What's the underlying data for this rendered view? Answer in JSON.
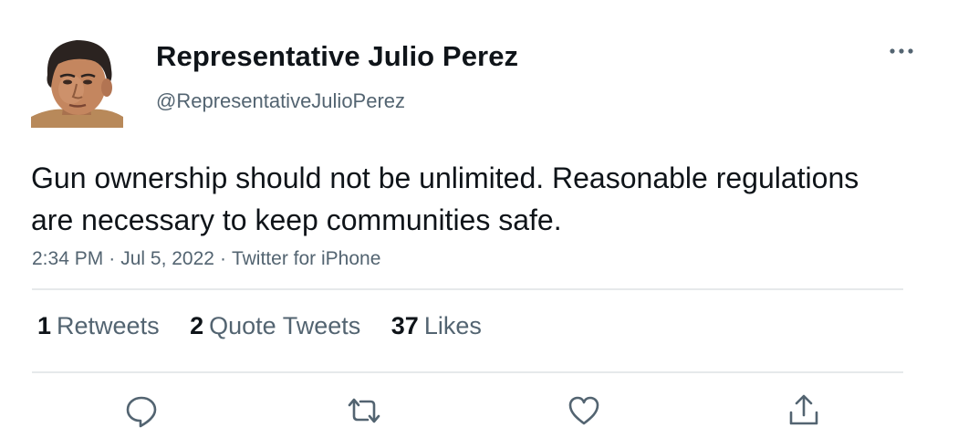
{
  "author": {
    "display_name": "Representative Julio Perez",
    "handle": "@RepresentativeJulioPerez",
    "avatar": "avatar-photo"
  },
  "tweet": {
    "text": "Gun ownership should not be unlimited. Reasonable regulations are necessary to keep communities safe.",
    "time": "2:34 PM",
    "date": "Jul 5, 2022",
    "source": "Twitter for iPhone",
    "separator": "·"
  },
  "stats": {
    "retweets": {
      "count": "1",
      "label": "Retweets"
    },
    "quote_tweets": {
      "count": "2",
      "label": "Quote Tweets"
    },
    "likes": {
      "count": "37",
      "label": "Likes"
    }
  },
  "actions": [
    {
      "name": "reply",
      "icon": "reply-icon"
    },
    {
      "name": "retweet",
      "icon": "retweet-icon"
    },
    {
      "name": "like",
      "icon": "heart-icon"
    },
    {
      "name": "share",
      "icon": "share-icon"
    }
  ],
  "colors": {
    "text_primary": "#0f1419",
    "text_secondary": "#536471",
    "divider": "#e6e9eb",
    "icon": "#536471"
  }
}
